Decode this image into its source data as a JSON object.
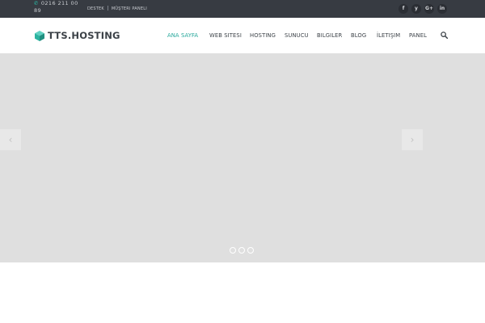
{
  "topbar": {
    "phone": "0216 211 00 89",
    "links": [
      "DESTEK",
      "MÜŞTERI PANELI"
    ],
    "social": [
      "f",
      "y",
      "G+",
      "in"
    ]
  },
  "header": {
    "logo_text": "TTS.HOSTING",
    "nav": [
      "ANA SAYFA",
      "WEB SITESI",
      "HOSTING",
      "SUNUCU",
      "BILGILER",
      "BLOG",
      "İLETIŞIM",
      "PANEL"
    ],
    "active_nav": "ANA SAYFA"
  },
  "slider": {
    "prev_label": "‹",
    "next_label": "›",
    "dot_count": 3
  },
  "colors": {
    "accent": "#26a89b",
    "topbar_bg": "#373b42",
    "slider_bg": "#dfdfdf"
  }
}
